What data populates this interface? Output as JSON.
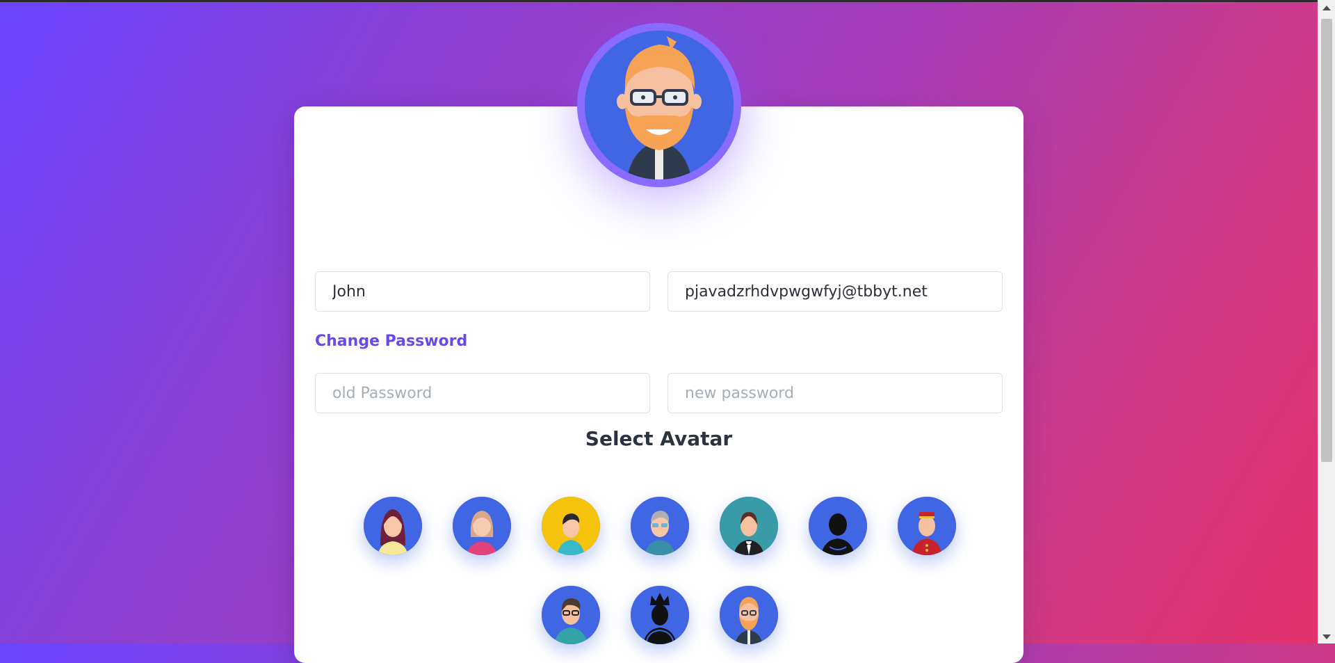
{
  "profile": {
    "name_value": "John",
    "email_value": "pjavadzrhdvpwgwfyj@tbbyt.net"
  },
  "password": {
    "heading": "Change Password",
    "old_placeholder": "old Password",
    "new_placeholder": "new password"
  },
  "avatars": {
    "title": "Select Avatar",
    "items": [
      {
        "icon": "woman-dark-hair-avatar-icon"
      },
      {
        "icon": "woman-blonde-avatar-icon"
      },
      {
        "icon": "boy-yellow-background-avatar-icon"
      },
      {
        "icon": "man-sunglasses-avatar-icon"
      },
      {
        "icon": "woman-tuxedo-avatar-icon"
      },
      {
        "icon": "silhouette-man-avatar-icon"
      },
      {
        "icon": "bellhop-avatar-icon"
      },
      {
        "icon": "man-glasses-avatar-icon"
      },
      {
        "icon": "king-silhouette-avatar-icon"
      },
      {
        "icon": "bearded-man-glasses-avatar-icon"
      }
    ],
    "selected_icon": "bearded-man-glasses-avatar-icon"
  },
  "colors": {
    "accent": "#6b48e8",
    "avatar_bg": "#4166e3"
  }
}
